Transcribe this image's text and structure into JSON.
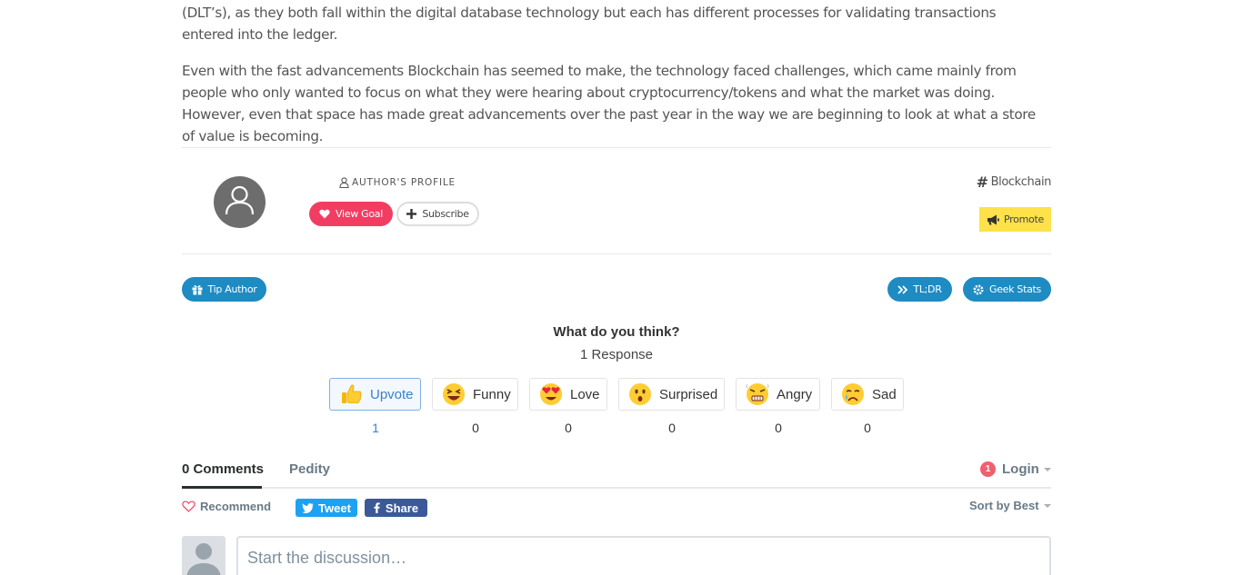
{
  "article": {
    "paragraph1": "(DLT’s), as they both fall within the digital database technology but each has different processes for validating transactions entered into the ledger.",
    "paragraph2": "Even with the fast advancements Blockchain has seemed to make, the technology faced challenges, which came mainly from people who only wanted to focus on what they were hearing about cryptocurrency/tokens and what the market was doing. However, even that space has made great advancements over the past year in the way we are beginning to look at what a store of value is becoming."
  },
  "author": {
    "profile_label": "AUTHOR'S PROFILE",
    "view_goal_label": "View Goal",
    "subscribe_label": "Subscribe"
  },
  "tag": {
    "label": "Blockchain"
  },
  "promote_label": "Promote",
  "actions": {
    "tip_author": "Tip Author",
    "tldr": "TL;DR",
    "geek_stats": "Geek Stats"
  },
  "reactions_section": {
    "title": "What do you think?",
    "responses": "1 Response",
    "items": [
      {
        "label": "Upvote",
        "count": "1",
        "icon": "thumbs-up-icon",
        "active": true
      },
      {
        "label": "Funny",
        "count": "0",
        "icon": "laughing-face-icon"
      },
      {
        "label": "Love",
        "count": "0",
        "icon": "heart-eyes-face-icon"
      },
      {
        "label": "Surprised",
        "count": "0",
        "icon": "surprised-face-icon"
      },
      {
        "label": "Angry",
        "count": "0",
        "icon": "angry-face-icon"
      },
      {
        "label": "Sad",
        "count": "0",
        "icon": "crying-face-icon"
      }
    ]
  },
  "comments": {
    "tab_comments": "0 Comments",
    "tab_pedity": "Pedity",
    "notification_count": "1",
    "login_label": "Login",
    "recommend_label": "Recommend",
    "tweet_label": "Tweet",
    "share_label": "Share",
    "sort_label": "Sort by Best",
    "composer_placeholder": "Start the discussion…"
  },
  "colors": {
    "goal_pink": "#f23d63",
    "primary_blue": "#1e8bc3",
    "promote_yellow": "#ffe14a",
    "twitter_blue": "#1da1f2",
    "facebook_blue": "#3b5998"
  }
}
